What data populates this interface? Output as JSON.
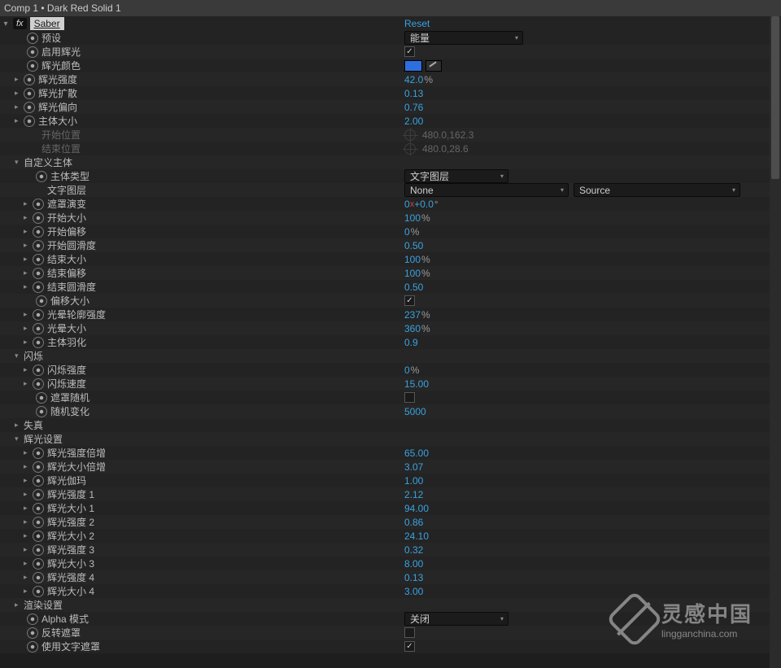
{
  "header": {
    "comp": "Comp 1",
    "sep": "•",
    "layer": "Dark Red Solid 1"
  },
  "fx": {
    "badge": "fx",
    "name": "Saber",
    "reset": "Reset"
  },
  "colors": {
    "glow_swatch": "#2d6fe0"
  },
  "p": {
    "preset": {
      "label": "预设",
      "value": "能量"
    },
    "enable_glow": {
      "label": "启用辉光",
      "checked": true
    },
    "glow_color": {
      "label": "辉光颜色"
    },
    "glow_intensity": {
      "label": "辉光强度",
      "value": "42.0",
      "unit": "%"
    },
    "glow_spread": {
      "label": "辉光扩散",
      "value": "0.13"
    },
    "glow_bias": {
      "label": "辉光偏向",
      "value": "0.76"
    },
    "core_size": {
      "label": "主体大小",
      "value": "2.00"
    },
    "start_pos": {
      "label": "开始位置",
      "value": "480.0,162.3"
    },
    "end_pos": {
      "label": "结束位置",
      "value": "480.0,28.6"
    }
  },
  "custom_core": {
    "header": "自定义主体",
    "core_type": {
      "label": "主体类型",
      "value": "文字图层"
    },
    "text_layer": {
      "label": "文字图层",
      "value": "None",
      "src": "Source"
    },
    "mask_evo": {
      "label": "遮罩演变",
      "rot_a": "0",
      "rot_b": "+0.0",
      "unit": "°"
    },
    "start_size": {
      "label": "开始大小",
      "value": "100",
      "unit": "%"
    },
    "start_offset": {
      "label": "开始偏移",
      "value": "0",
      "unit": "%"
    },
    "start_round": {
      "label": "开始圆滑度",
      "value": "0.50"
    },
    "end_size": {
      "label": "结束大小",
      "value": "100",
      "unit": "%"
    },
    "end_offset": {
      "label": "结束偏移",
      "value": "100",
      "unit": "%"
    },
    "end_round": {
      "label": "结束圆滑度",
      "value": "0.50"
    },
    "offset_size": {
      "label": "偏移大小",
      "checked": true
    },
    "halo_int": {
      "label": "光晕轮廓强度",
      "value": "237",
      "unit": "%"
    },
    "halo_size": {
      "label": "光晕大小",
      "value": "360",
      "unit": "%"
    },
    "core_feather": {
      "label": "主体羽化",
      "value": "0.9"
    }
  },
  "flicker": {
    "header": "闪烁",
    "intensity": {
      "label": "闪烁强度",
      "value": "0",
      "unit": "%"
    },
    "speed": {
      "label": "闪烁速度",
      "value": "15.00"
    },
    "mask_random": {
      "label": "遮罩随机",
      "checked": false
    },
    "random": {
      "label": "随机变化",
      "value": "5000"
    }
  },
  "distort": {
    "header": "失真"
  },
  "glow": {
    "header": "辉光设置",
    "int_mult": {
      "label": "辉光强度倍增",
      "value": "65.00"
    },
    "size_mult": {
      "label": "辉光大小倍增",
      "value": "3.07"
    },
    "gamma": {
      "label": "辉光伽玛",
      "value": "1.00"
    },
    "int1": {
      "label": "辉光强度 1",
      "value": "2.12"
    },
    "size1": {
      "label": "辉光大小 1",
      "value": "94.00"
    },
    "int2": {
      "label": "辉光强度 2",
      "value": "0.86"
    },
    "size2": {
      "label": "辉光大小 2",
      "value": "24.10"
    },
    "int3": {
      "label": "辉光强度 3",
      "value": "0.32"
    },
    "size3": {
      "label": "辉光大小 3",
      "value": "8.00"
    },
    "int4": {
      "label": "辉光强度 4",
      "value": "0.13"
    },
    "size4": {
      "label": "辉光大小 4",
      "value": "3.00"
    }
  },
  "render": {
    "header": "渲染设置",
    "alpha": {
      "label": "Alpha 模式",
      "value": "关闭"
    },
    "invert": {
      "label": "反转遮罩",
      "checked": false
    },
    "use_text": {
      "label": "使用文字遮罩",
      "checked": true
    }
  },
  "watermark": {
    "cn": "灵感中国",
    "en1": "linggan",
    "en2": "china",
    "tld": ".com"
  }
}
